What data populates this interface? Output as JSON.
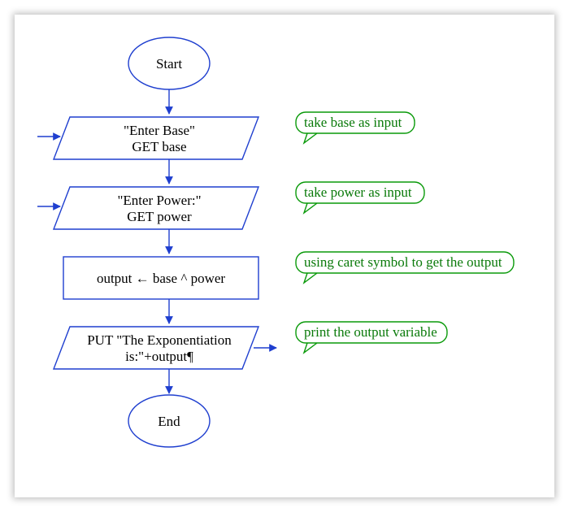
{
  "flow": {
    "start": "Start",
    "end": "End",
    "input1_line1": "\"Enter Base\"",
    "input1_line2": "GET base",
    "input2_line1": "\"Enter Power:\"",
    "input2_line2": "GET power",
    "process_line1": "output ← base ^ power",
    "output_line1": "PUT \"The Exponentiation",
    "output_line2": "is:\"+output¶"
  },
  "callouts": {
    "c1": "take base as input",
    "c2": "take power as input",
    "c3": "using caret symbol to get the output",
    "c4": "print the output variable"
  },
  "colors": {
    "stroke": "#1f3fcf",
    "callout": "#0a9a0a"
  }
}
